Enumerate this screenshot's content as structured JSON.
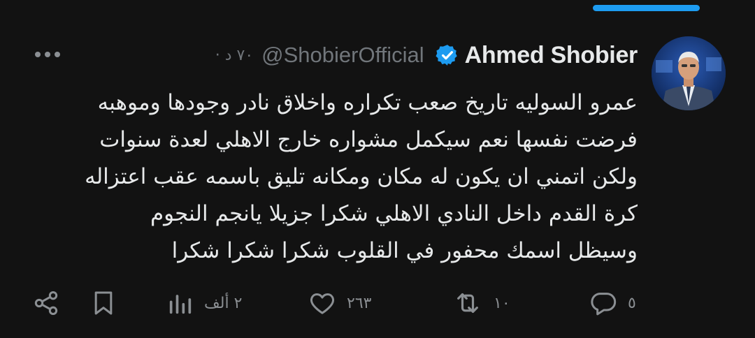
{
  "colors": {
    "background": "#121212",
    "accent": "#1d9bf0",
    "text": "#e7e9ea",
    "muted": "#71767b"
  },
  "tweet": {
    "author_name": "Ahmed Shobier",
    "verified_icon": "verified-badge-icon",
    "handle": "@ShobierOfficial",
    "timestamp": "· ٧٠ د",
    "lines": [
      "عمرو السوليه تاريخ صعب تكراره واخلاق نادر وجودها وموهبه",
      "فرضت نفسها نعم سيكمل مشواره خارج الاهلي لعدة سنوات",
      "ولكن اتمني ان يكون له مكان ومكانه تليق باسمه عقب اعتزاله",
      "كرة القدم  داخل النادي الاهلي شكرا جزيلا يانجم النجوم",
      "وسيظل اسمك محفور في القلوب شكرا شكرا شكرا"
    ]
  },
  "actions": {
    "reply": {
      "icon": "reply-icon",
      "count": "٥"
    },
    "retweet": {
      "icon": "retweet-icon",
      "count": "١٠"
    },
    "like": {
      "icon": "heart-icon",
      "count": "٢٦٣"
    },
    "views": {
      "icon": "views-icon",
      "count": "٢ ألف"
    },
    "bookmark": {
      "icon": "bookmark-icon"
    },
    "share": {
      "icon": "share-icon"
    }
  }
}
